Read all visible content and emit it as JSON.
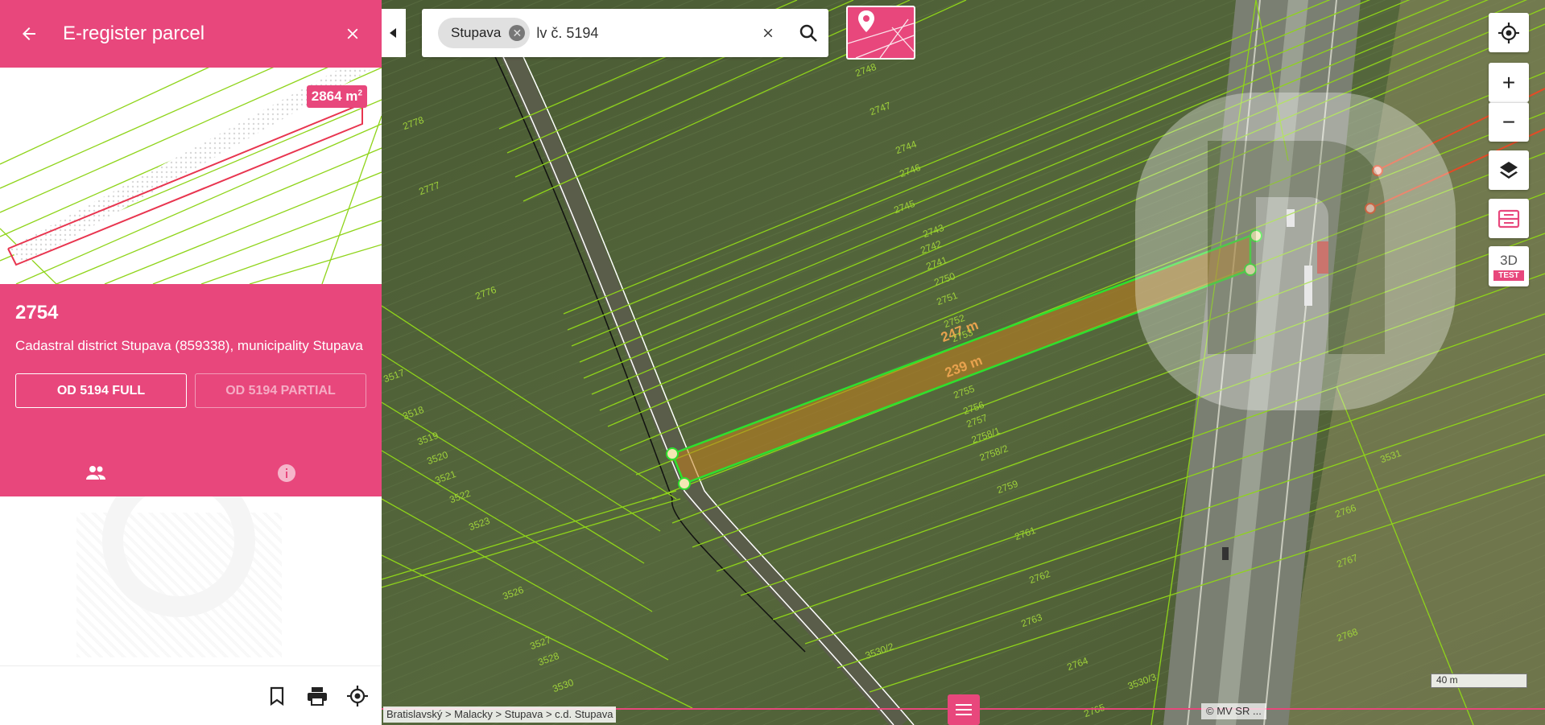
{
  "panel": {
    "title": "E-register parcel",
    "back_icon": "arrow-left-icon",
    "close_icon": "close-icon",
    "area_value": "2864 m",
    "area_unit_sup": "2",
    "parcel_number": "2754",
    "description": "Cadastral district Stupava (859338), municipality Stupava",
    "button_full": "OD 5194 FULL",
    "button_partial": "OD 5194 PARTIAL",
    "tabs": [
      {
        "icon": "people-icon"
      },
      {
        "icon": "info-icon"
      }
    ],
    "footer_icons": [
      "bookmark-icon",
      "print-icon",
      "locate-icon"
    ]
  },
  "search": {
    "chip_label": "Stupava",
    "query": "lv č. 5194",
    "clear_icon": "close-icon",
    "search_icon": "search-icon"
  },
  "map": {
    "measure_top": "247 m",
    "measure_bottom": "239 m",
    "parcel_labels": [
      "2778",
      "2777",
      "2776",
      "2748",
      "2747",
      "2746",
      "2745",
      "2744",
      "2743",
      "2742",
      "2741",
      "2750",
      "2751",
      "2752",
      "2753",
      "2755",
      "2756",
      "2757",
      "2758/1",
      "2758/2",
      "2759",
      "2761",
      "2762",
      "2763",
      "2764",
      "2765",
      "2766",
      "2767",
      "2768",
      "3517",
      "3518",
      "3519",
      "3520",
      "3521",
      "3522",
      "3523",
      "3526",
      "3527",
      "3528",
      "3530",
      "3530/2",
      "3530/3",
      "3531"
    ],
    "scale": "40 m",
    "breadcrumb": "Bratislavský > Malacky > Stupava > c.d. Stupava",
    "copyright": "© MV SR ..."
  },
  "controls": {
    "locate_icon": "crosshair-icon",
    "zoom_in": "+",
    "zoom_out": "−",
    "layers_icon": "layers-icon",
    "parcel_icon": "parcel-info-icon",
    "threed_label": "3D",
    "threed_badge": "TEST"
  },
  "colors": {
    "accent": "#e8477c",
    "parcel_line": "#8fd41a",
    "selection_fill": "#c57f1e"
  }
}
